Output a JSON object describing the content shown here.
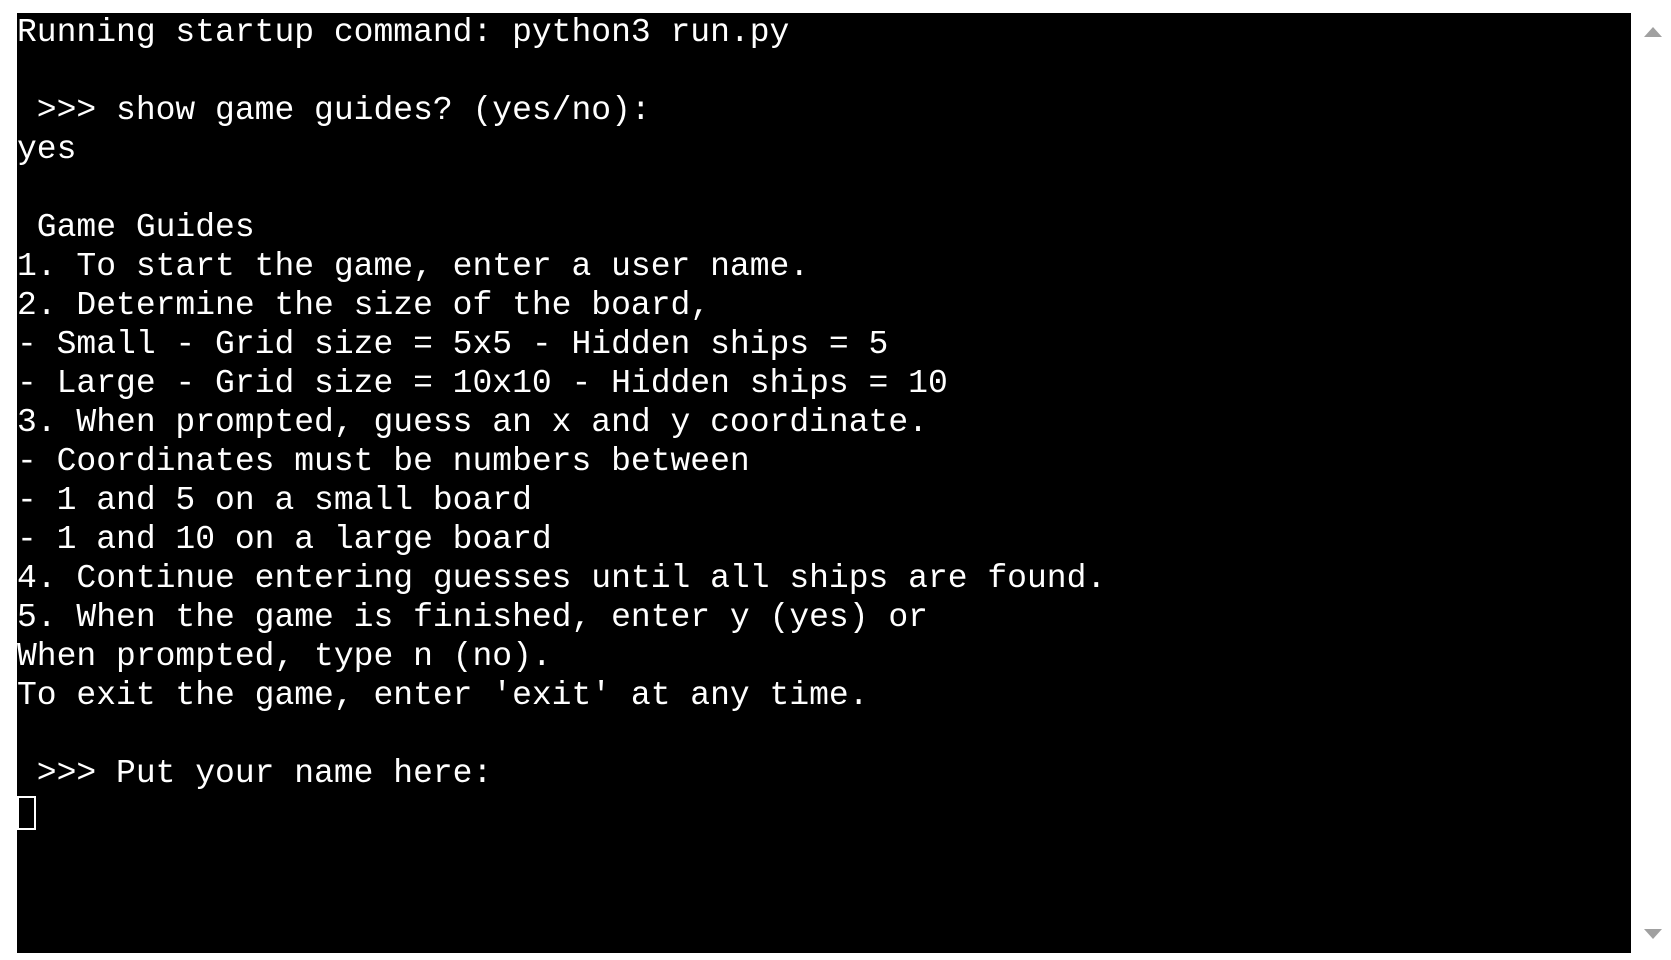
{
  "terminal": {
    "lines": [
      "Running startup command: python3 run.py",
      "",
      " >>> show game guides? (yes/no):",
      "yes",
      "",
      " Game Guides",
      "1. To start the game, enter a user name.",
      "2. Determine the size of the board,",
      "- Small - Grid size = 5x5 - Hidden ships = 5",
      "- Large - Grid size = 10x10 - Hidden ships = 10",
      "3. When prompted, guess an x and y coordinate.",
      "- Coordinates must be numbers between",
      "- 1 and 5 on a small board",
      "- 1 and 10 on a large board",
      "4. Continue entering guesses until all ships are found.",
      "5. When the game is finished, enter y (yes) or",
      "When prompted, type n (no).",
      "To exit the game, enter 'exit' at any time.",
      "",
      " >>> Put your name here:"
    ]
  },
  "scrollbar": {
    "up_icon": "triangle-up",
    "down_icon": "triangle-down",
    "arrow_color": "#a0a0a0"
  },
  "colors": {
    "terminal_background": "#000000",
    "terminal_text": "#ffffff"
  }
}
